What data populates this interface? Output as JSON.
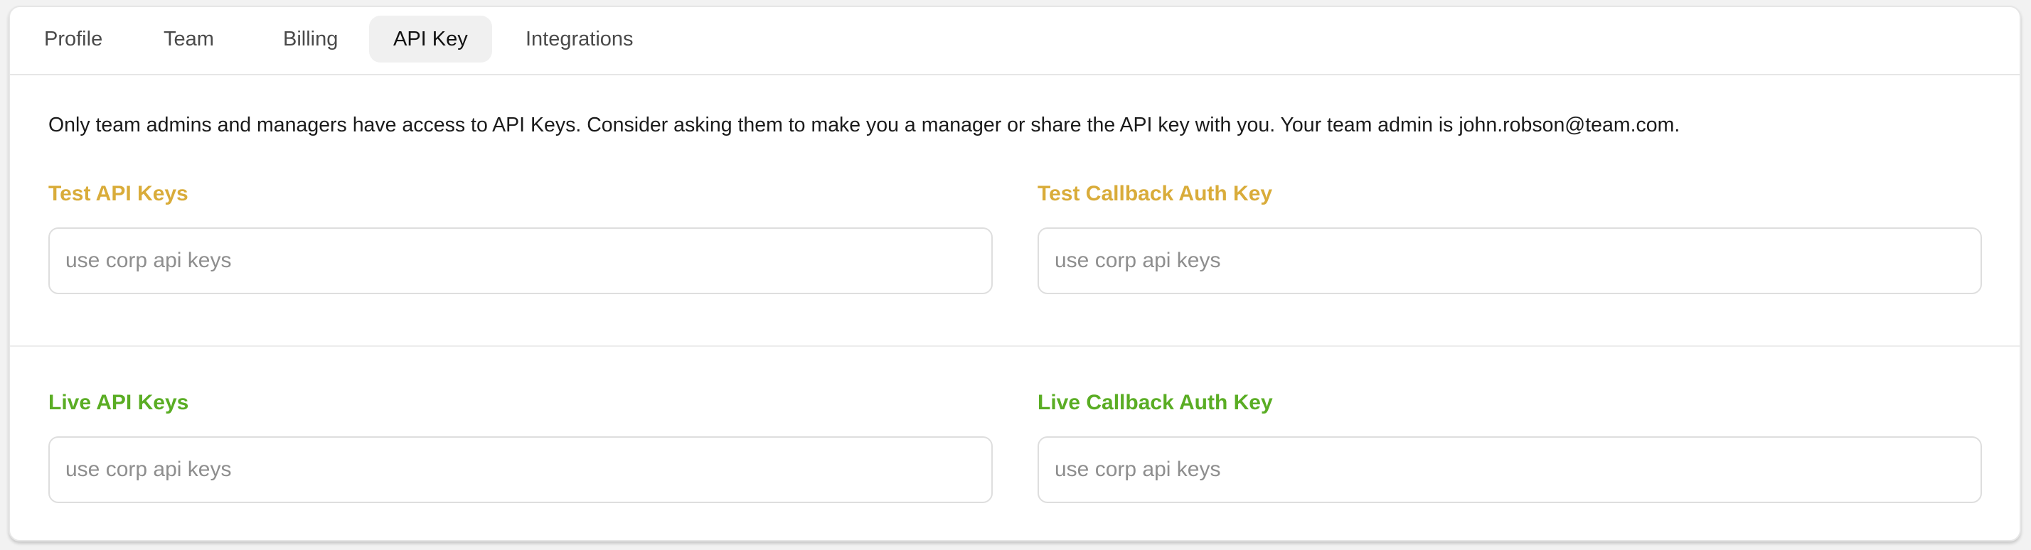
{
  "tabs": [
    {
      "label": "Profile",
      "active": false
    },
    {
      "label": "Team",
      "active": false
    },
    {
      "label": "Billing",
      "active": false
    },
    {
      "label": "API Key",
      "active": true
    },
    {
      "label": "Integrations",
      "active": false
    }
  ],
  "notice": "Only team admins and managers have access to API Keys. Consider asking them to make you a manager or share the API key with you. Your team admin is john.robson@team.com.",
  "test": {
    "api_keys_label": "Test API Keys",
    "api_keys_placeholder": "use corp api keys",
    "callback_label": "Test Callback Auth Key",
    "callback_placeholder": "use corp api keys"
  },
  "live": {
    "api_keys_label": "Live API Keys",
    "api_keys_placeholder": "use corp api keys",
    "callback_label": "Live Callback Auth Key",
    "callback_placeholder": "use corp api keys"
  },
  "colors": {
    "test_label": "#d9ac3a",
    "live_label": "#5aad24",
    "active_tab_bg": "#f0f0f0"
  }
}
